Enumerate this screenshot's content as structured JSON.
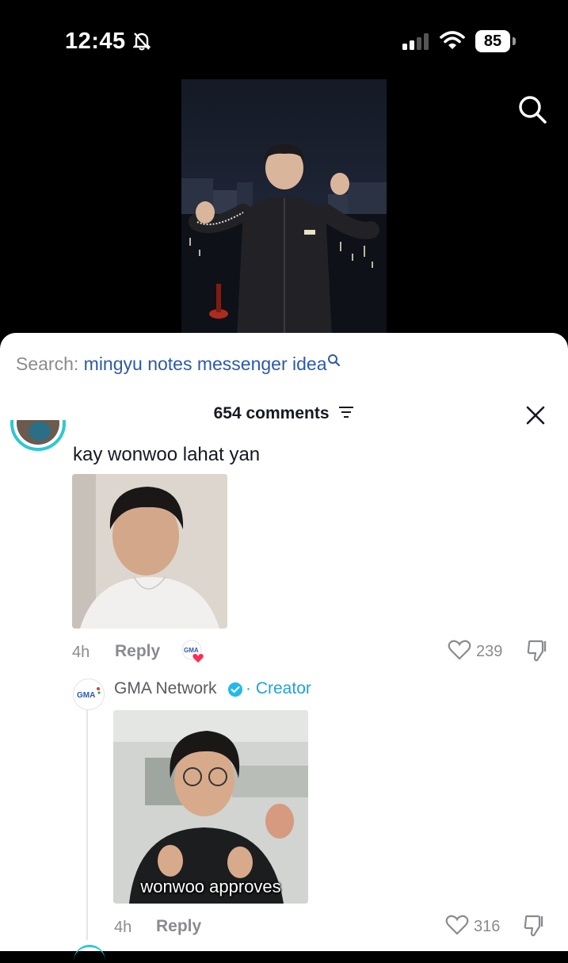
{
  "status_bar": {
    "time": "12:45",
    "battery": "85"
  },
  "search": {
    "prefix": "Search:",
    "term": "mingyu notes messenger idea"
  },
  "comments_header": {
    "count_label": "654 comments"
  },
  "comment": {
    "text": "kay wonwoo lahat yan",
    "time": "4h",
    "reply_label": "Reply",
    "likes": "239"
  },
  "reply": {
    "author": "GMA Network",
    "separator": "·",
    "badge": "Creator",
    "caption": "wonwoo approves",
    "time": "4h",
    "reply_label": "Reply",
    "likes": "316"
  },
  "icons": {
    "bell": "bell-slash-icon",
    "search": "search-icon",
    "sort": "sort-icon",
    "close": "close-icon",
    "like": "heart-icon",
    "dislike": "thumbs-down-icon",
    "verified": "verified-badge-icon"
  },
  "colors": {
    "accent_blue": "#2d5aa8",
    "creator": "#1fa4d4",
    "verified": "#20b9f0",
    "ring": "#2fc7d4"
  }
}
